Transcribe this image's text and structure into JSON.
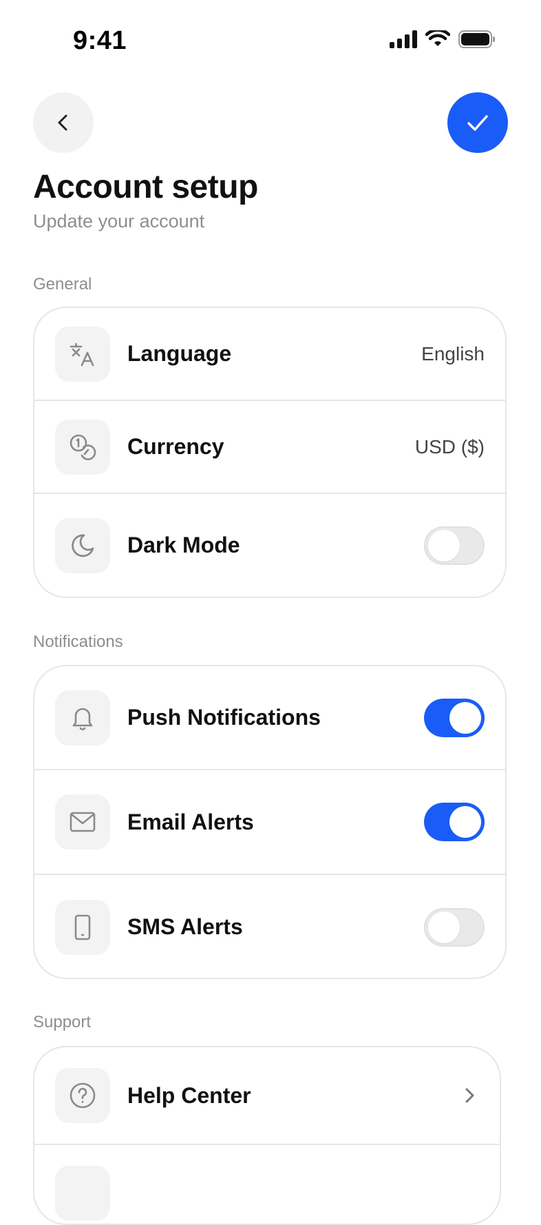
{
  "status_bar": {
    "time": "9:41"
  },
  "header": {
    "title": "Account setup",
    "subtitle": "Update your account"
  },
  "sections": {
    "general": {
      "label": "General",
      "items": [
        {
          "icon": "translate-icon",
          "label": "Language",
          "value": "English"
        },
        {
          "icon": "coins-icon",
          "label": "Currency",
          "value": "USD ($)"
        },
        {
          "icon": "moon-icon",
          "label": "Dark Mode",
          "toggle": false
        }
      ]
    },
    "notifications": {
      "label": "Notifications",
      "items": [
        {
          "icon": "bell-icon",
          "label": "Push Notifications",
          "toggle": true
        },
        {
          "icon": "mail-icon",
          "label": "Email Alerts",
          "toggle": true
        },
        {
          "icon": "phone-icon",
          "label": "SMS Alerts",
          "toggle": false
        }
      ]
    },
    "support": {
      "label": "Support",
      "items": [
        {
          "icon": "help-icon",
          "label": "Help Center"
        }
      ]
    }
  },
  "colors": {
    "accent": "#1a5cf7",
    "icon_gray": "#8a8a8a",
    "border": "#e6e6e6"
  }
}
